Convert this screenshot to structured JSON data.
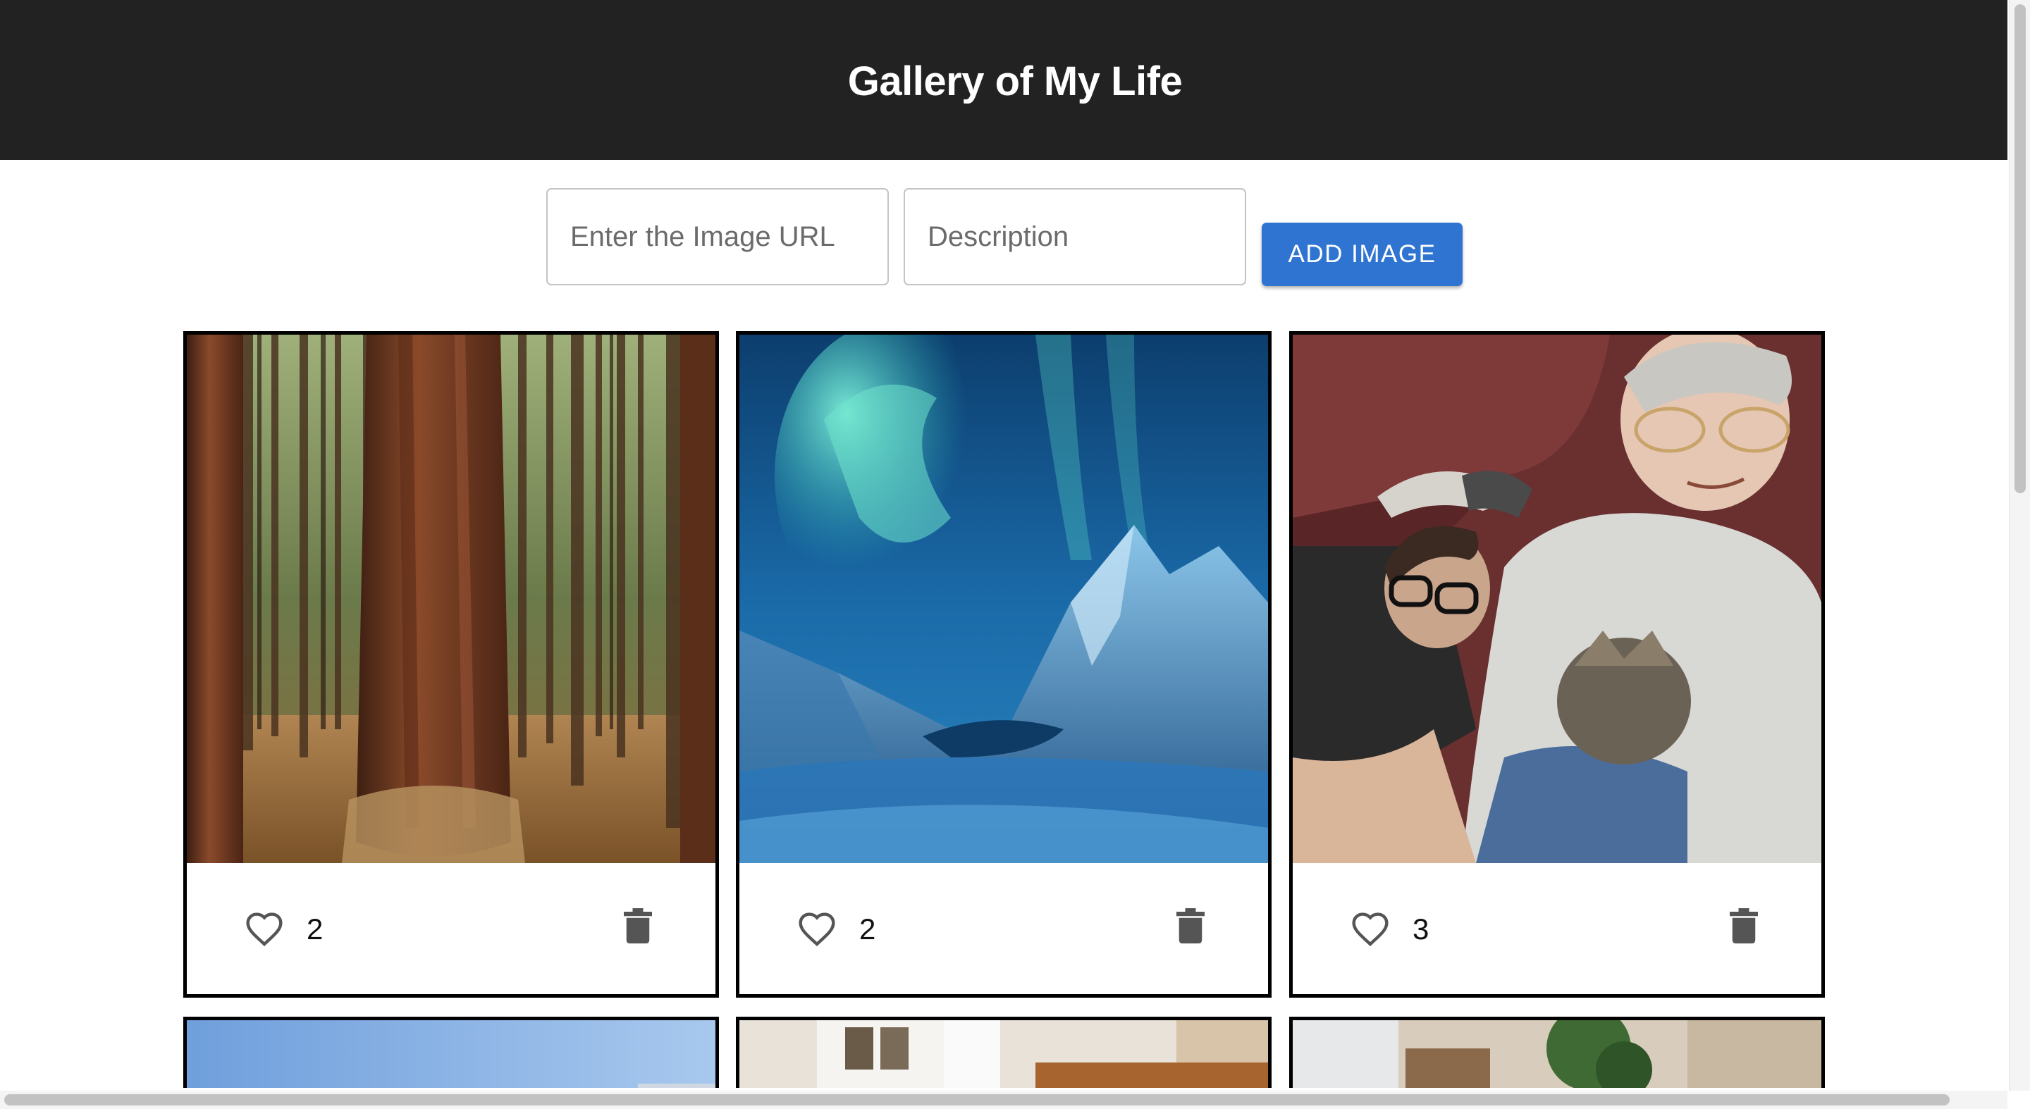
{
  "header": {
    "title": "Gallery of My Life"
  },
  "form": {
    "url_placeholder": "Enter the Image URL",
    "description_placeholder": "Description",
    "add_button_label": "ADD IMAGE"
  },
  "cards": [
    {
      "likes": "2",
      "icons": [
        "heart-outline-icon",
        "trash-icon"
      ]
    },
    {
      "likes": "2",
      "icons": [
        "heart-outline-icon",
        "trash-icon"
      ]
    },
    {
      "likes": "3",
      "icons": [
        "heart-outline-icon",
        "trash-icon"
      ]
    }
  ],
  "colors": {
    "header_bg": "#222222",
    "button": "#2f74d0",
    "card_border": "#000000",
    "icon": "#555555"
  }
}
